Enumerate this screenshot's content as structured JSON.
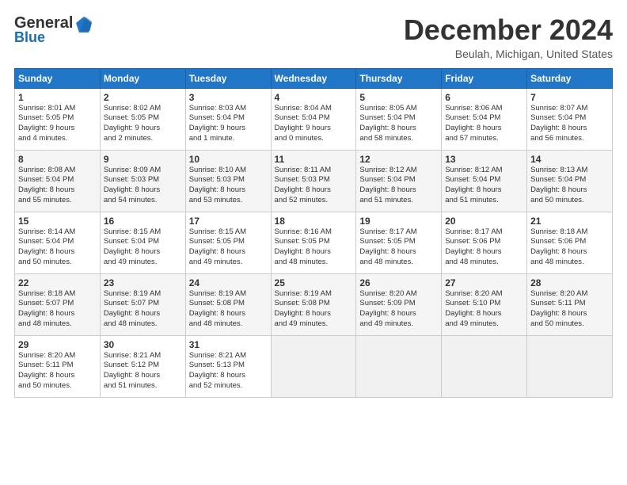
{
  "header": {
    "logo_general": "General",
    "logo_blue": "Blue",
    "title": "December 2024",
    "location": "Beulah, Michigan, United States"
  },
  "days_of_week": [
    "Sunday",
    "Monday",
    "Tuesday",
    "Wednesday",
    "Thursday",
    "Friday",
    "Saturday"
  ],
  "weeks": [
    [
      {
        "day": "1",
        "lines": [
          "Sunrise: 8:01 AM",
          "Sunset: 5:05 PM",
          "Daylight: 9 hours",
          "and 4 minutes."
        ]
      },
      {
        "day": "2",
        "lines": [
          "Sunrise: 8:02 AM",
          "Sunset: 5:05 PM",
          "Daylight: 9 hours",
          "and 2 minutes."
        ]
      },
      {
        "day": "3",
        "lines": [
          "Sunrise: 8:03 AM",
          "Sunset: 5:04 PM",
          "Daylight: 9 hours",
          "and 1 minute."
        ]
      },
      {
        "day": "4",
        "lines": [
          "Sunrise: 8:04 AM",
          "Sunset: 5:04 PM",
          "Daylight: 9 hours",
          "and 0 minutes."
        ]
      },
      {
        "day": "5",
        "lines": [
          "Sunrise: 8:05 AM",
          "Sunset: 5:04 PM",
          "Daylight: 8 hours",
          "and 58 minutes."
        ]
      },
      {
        "day": "6",
        "lines": [
          "Sunrise: 8:06 AM",
          "Sunset: 5:04 PM",
          "Daylight: 8 hours",
          "and 57 minutes."
        ]
      },
      {
        "day": "7",
        "lines": [
          "Sunrise: 8:07 AM",
          "Sunset: 5:04 PM",
          "Daylight: 8 hours",
          "and 56 minutes."
        ]
      }
    ],
    [
      {
        "day": "8",
        "lines": [
          "Sunrise: 8:08 AM",
          "Sunset: 5:04 PM",
          "Daylight: 8 hours",
          "and 55 minutes."
        ]
      },
      {
        "day": "9",
        "lines": [
          "Sunrise: 8:09 AM",
          "Sunset: 5:03 PM",
          "Daylight: 8 hours",
          "and 54 minutes."
        ]
      },
      {
        "day": "10",
        "lines": [
          "Sunrise: 8:10 AM",
          "Sunset: 5:03 PM",
          "Daylight: 8 hours",
          "and 53 minutes."
        ]
      },
      {
        "day": "11",
        "lines": [
          "Sunrise: 8:11 AM",
          "Sunset: 5:03 PM",
          "Daylight: 8 hours",
          "and 52 minutes."
        ]
      },
      {
        "day": "12",
        "lines": [
          "Sunrise: 8:12 AM",
          "Sunset: 5:04 PM",
          "Daylight: 8 hours",
          "and 51 minutes."
        ]
      },
      {
        "day": "13",
        "lines": [
          "Sunrise: 8:12 AM",
          "Sunset: 5:04 PM",
          "Daylight: 8 hours",
          "and 51 minutes."
        ]
      },
      {
        "day": "14",
        "lines": [
          "Sunrise: 8:13 AM",
          "Sunset: 5:04 PM",
          "Daylight: 8 hours",
          "and 50 minutes."
        ]
      }
    ],
    [
      {
        "day": "15",
        "lines": [
          "Sunrise: 8:14 AM",
          "Sunset: 5:04 PM",
          "Daylight: 8 hours",
          "and 50 minutes."
        ]
      },
      {
        "day": "16",
        "lines": [
          "Sunrise: 8:15 AM",
          "Sunset: 5:04 PM",
          "Daylight: 8 hours",
          "and 49 minutes."
        ]
      },
      {
        "day": "17",
        "lines": [
          "Sunrise: 8:15 AM",
          "Sunset: 5:05 PM",
          "Daylight: 8 hours",
          "and 49 minutes."
        ]
      },
      {
        "day": "18",
        "lines": [
          "Sunrise: 8:16 AM",
          "Sunset: 5:05 PM",
          "Daylight: 8 hours",
          "and 48 minutes."
        ]
      },
      {
        "day": "19",
        "lines": [
          "Sunrise: 8:17 AM",
          "Sunset: 5:05 PM",
          "Daylight: 8 hours",
          "and 48 minutes."
        ]
      },
      {
        "day": "20",
        "lines": [
          "Sunrise: 8:17 AM",
          "Sunset: 5:06 PM",
          "Daylight: 8 hours",
          "and 48 minutes."
        ]
      },
      {
        "day": "21",
        "lines": [
          "Sunrise: 8:18 AM",
          "Sunset: 5:06 PM",
          "Daylight: 8 hours",
          "and 48 minutes."
        ]
      }
    ],
    [
      {
        "day": "22",
        "lines": [
          "Sunrise: 8:18 AM",
          "Sunset: 5:07 PM",
          "Daylight: 8 hours",
          "and 48 minutes."
        ]
      },
      {
        "day": "23",
        "lines": [
          "Sunrise: 8:19 AM",
          "Sunset: 5:07 PM",
          "Daylight: 8 hours",
          "and 48 minutes."
        ]
      },
      {
        "day": "24",
        "lines": [
          "Sunrise: 8:19 AM",
          "Sunset: 5:08 PM",
          "Daylight: 8 hours",
          "and 48 minutes."
        ]
      },
      {
        "day": "25",
        "lines": [
          "Sunrise: 8:19 AM",
          "Sunset: 5:08 PM",
          "Daylight: 8 hours",
          "and 49 minutes."
        ]
      },
      {
        "day": "26",
        "lines": [
          "Sunrise: 8:20 AM",
          "Sunset: 5:09 PM",
          "Daylight: 8 hours",
          "and 49 minutes."
        ]
      },
      {
        "day": "27",
        "lines": [
          "Sunrise: 8:20 AM",
          "Sunset: 5:10 PM",
          "Daylight: 8 hours",
          "and 49 minutes."
        ]
      },
      {
        "day": "28",
        "lines": [
          "Sunrise: 8:20 AM",
          "Sunset: 5:11 PM",
          "Daylight: 8 hours",
          "and 50 minutes."
        ]
      }
    ],
    [
      {
        "day": "29",
        "lines": [
          "Sunrise: 8:20 AM",
          "Sunset: 5:11 PM",
          "Daylight: 8 hours",
          "and 50 minutes."
        ]
      },
      {
        "day": "30",
        "lines": [
          "Sunrise: 8:21 AM",
          "Sunset: 5:12 PM",
          "Daylight: 8 hours",
          "and 51 minutes."
        ]
      },
      {
        "day": "31",
        "lines": [
          "Sunrise: 8:21 AM",
          "Sunset: 5:13 PM",
          "Daylight: 8 hours",
          "and 52 minutes."
        ]
      },
      null,
      null,
      null,
      null
    ]
  ]
}
